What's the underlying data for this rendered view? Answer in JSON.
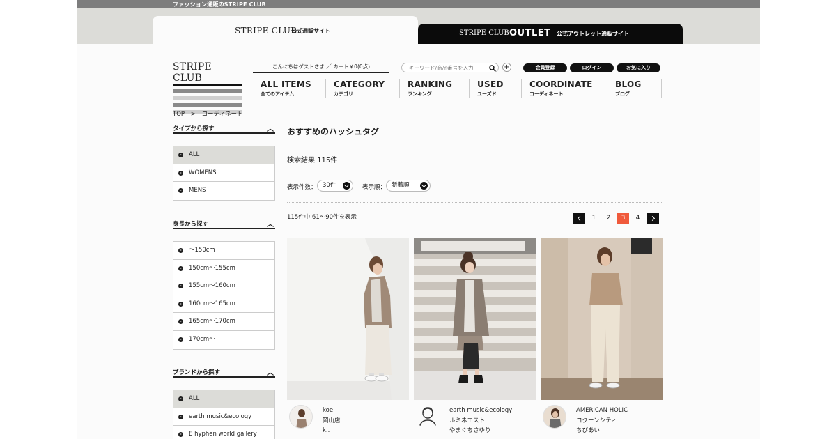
{
  "top_strip": {
    "text": "ファッション通販のSTRIPE CLUB"
  },
  "tabs": {
    "main": {
      "logo": "STRIPE CLUB",
      "sub": "公式通販サイト"
    },
    "outlet": {
      "logo": "STRIPE CLUB",
      "outlet": "OUTLET",
      "sub": "公式アウトレット通販サイト"
    }
  },
  "header": {
    "logo": "STRIPE CLUB",
    "greeting": "こんにちはゲストさま ／ カート￥0(0点)",
    "search_placeholder": "キーワード/商品番号を入力",
    "buttons": {
      "register": "会員登録",
      "login": "ログイン",
      "favorites": "お気に入り"
    }
  },
  "nav": [
    {
      "en": "ALL ITEMS",
      "ja": "全てのアイテム"
    },
    {
      "en": "CATEGORY",
      "ja": "カテゴリ"
    },
    {
      "en": "RANKING",
      "ja": "ランキング"
    },
    {
      "en": "USED",
      "ja": "ユーズド"
    },
    {
      "en": "COORDINATE",
      "ja": "コーディネート"
    },
    {
      "en": "BLOG",
      "ja": "ブログ"
    }
  ],
  "breadcrumb": {
    "top": "TOP",
    "sep": ">",
    "current": "コーディネート"
  },
  "sidebar": {
    "type": {
      "heading": "タイプから探す",
      "items": [
        "ALL",
        "WOMENS",
        "MENS"
      ]
    },
    "height": {
      "heading": "身長から探す",
      "items": [
        "〜150cm",
        "150cm〜155cm",
        "155cm〜160cm",
        "160cm〜165cm",
        "165cm〜170cm",
        "170cm〜"
      ]
    },
    "brand": {
      "heading": "ブランドから探す",
      "items": [
        "ALL",
        "earth music&ecology",
        "E hyphen world gallery"
      ]
    }
  },
  "main": {
    "title": "おすすめのハッシュタグ",
    "result_count": "検索結果 115件",
    "per_page_label": "表示件数：",
    "per_page_value": "30件",
    "sort_label": "表示順：",
    "sort_value": "新着順",
    "range_text": "115件中 61〜90件を表示"
  },
  "pager": {
    "pages": [
      "1",
      "2",
      "3",
      "4"
    ],
    "current": "3"
  },
  "cards": [
    {
      "brand": "koe",
      "shop": "岡山店",
      "staff": "k.."
    },
    {
      "brand": "earth music&ecology",
      "shop": "ルミネエスト",
      "staff": "やまぐちさゆり"
    },
    {
      "brand": "AMERICAN HOLIC",
      "shop": "コクーンシティ",
      "staff": "ちびあい"
    }
  ],
  "colors": {
    "accent": "#f05a3c",
    "dark": "#111111",
    "band": "#dcdcd8"
  }
}
